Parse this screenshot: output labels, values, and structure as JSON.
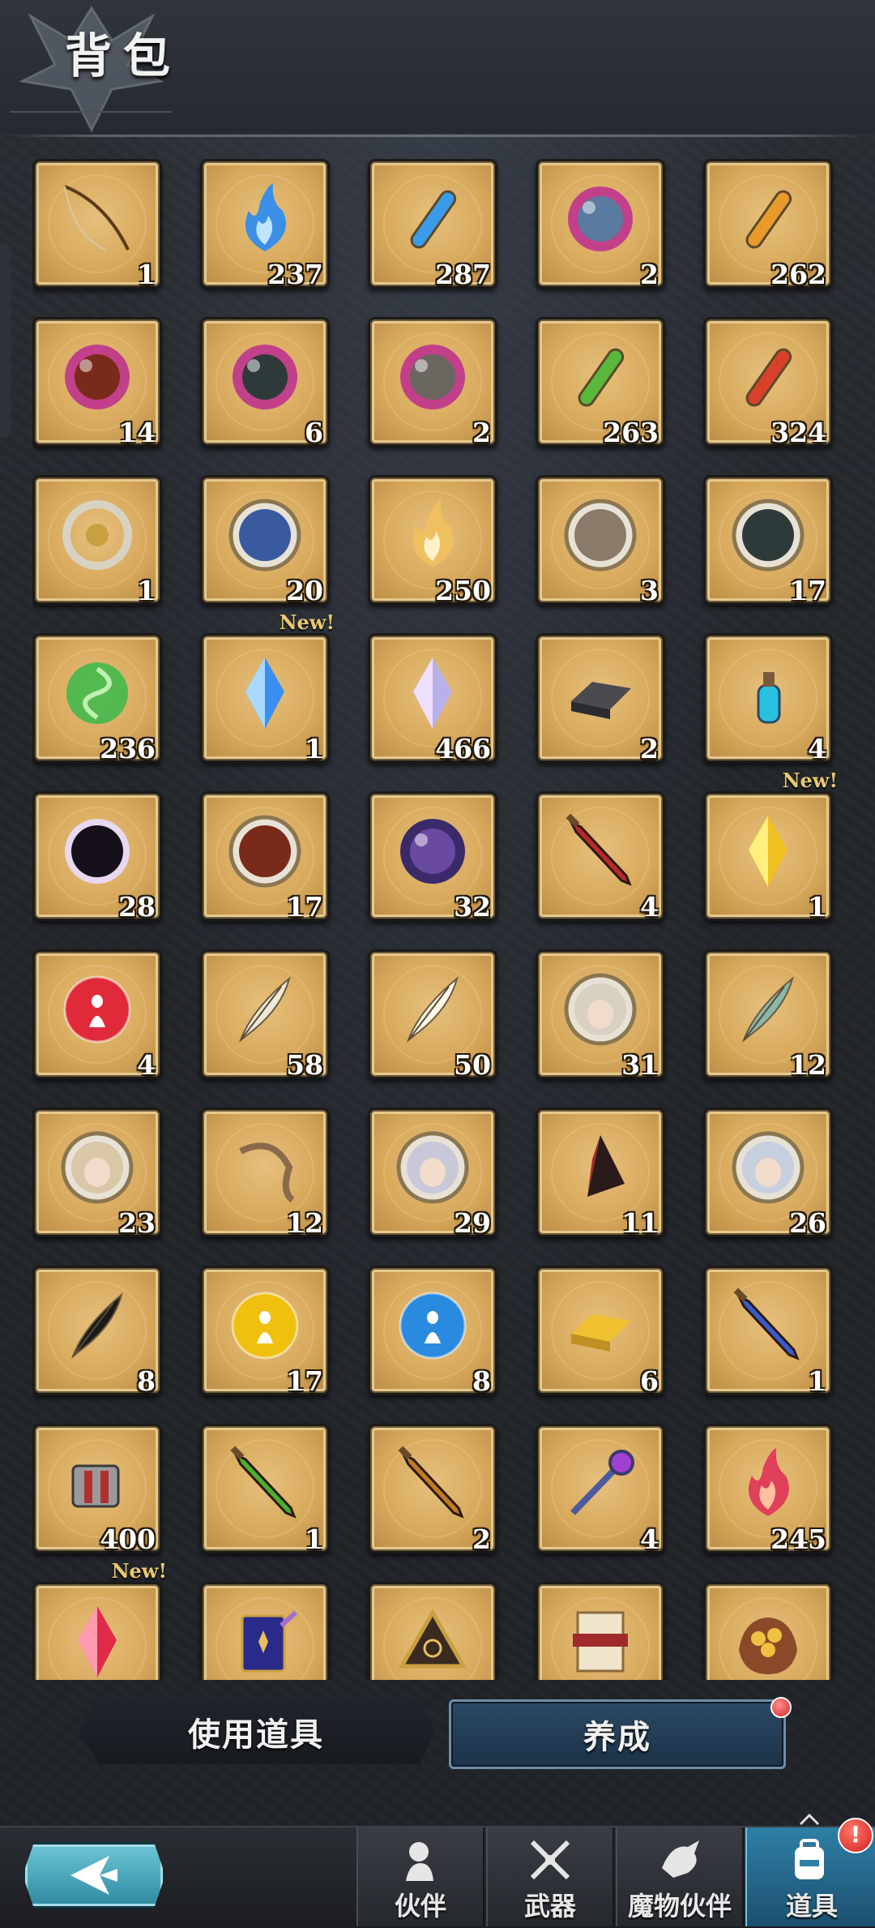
{
  "header": {
    "title": "背包"
  },
  "items": [
    {
      "icon": "fishing-rod-icon",
      "count": "1",
      "new": false
    },
    {
      "icon": "blue-flame-icon",
      "count": "237",
      "new": false
    },
    {
      "icon": "blue-vial-icon",
      "count": "287",
      "new": false
    },
    {
      "icon": "beast-orb-icon",
      "count": "2",
      "new": false
    },
    {
      "icon": "orange-vial-icon",
      "count": "262",
      "new": false
    },
    {
      "icon": "fire-orb-icon",
      "count": "14",
      "new": false
    },
    {
      "icon": "shadow-orb-icon",
      "count": "6",
      "new": false
    },
    {
      "icon": "stone-orb-icon",
      "count": "2",
      "new": false
    },
    {
      "icon": "green-vial-icon",
      "count": "263",
      "new": false
    },
    {
      "icon": "red-vial-icon",
      "count": "324",
      "new": false
    },
    {
      "icon": "silver-crest-icon",
      "count": "1",
      "new": false
    },
    {
      "icon": "blue-wave-medal-icon",
      "count": "20",
      "new": false
    },
    {
      "icon": "golden-flame-icon",
      "count": "250",
      "new": false
    },
    {
      "icon": "stone-medal-icon",
      "count": "3",
      "new": false
    },
    {
      "icon": "dark-medal-icon",
      "count": "17",
      "new": false
    },
    {
      "icon": "green-swirl-icon",
      "count": "236",
      "new": false
    },
    {
      "icon": "blue-crystal-icon",
      "count": "1",
      "new": true
    },
    {
      "icon": "prism-crystal-icon",
      "count": "466",
      "new": false
    },
    {
      "icon": "silver-ingot-icon",
      "count": "2",
      "new": false
    },
    {
      "icon": "cyan-potion-icon",
      "count": "4",
      "new": false
    },
    {
      "icon": "black-hole-icon",
      "count": "28",
      "new": false
    },
    {
      "icon": "lava-medal-icon",
      "count": "17",
      "new": false
    },
    {
      "icon": "purple-eye-orb-icon",
      "count": "32",
      "new": false
    },
    {
      "icon": "red-blade-icon",
      "count": "4",
      "new": false
    },
    {
      "icon": "gold-crystal-icon",
      "count": "1",
      "new": true
    },
    {
      "icon": "red-spirit-orb-icon",
      "count": "4",
      "new": false
    },
    {
      "icon": "white-feather-icon",
      "count": "58",
      "new": false
    },
    {
      "icon": "shining-feather-icon",
      "count": "50",
      "new": false
    },
    {
      "icon": "wolf-portrait-icon",
      "count": "31",
      "new": false
    },
    {
      "icon": "teal-feather-icon",
      "count": "12",
      "new": false
    },
    {
      "icon": "maiden-portrait-icon",
      "count": "23",
      "new": false
    },
    {
      "icon": "curved-horn-icon",
      "count": "12",
      "new": false
    },
    {
      "icon": "horned-girl-portrait-icon",
      "count": "29",
      "new": false
    },
    {
      "icon": "dark-fin-icon",
      "count": "11",
      "new": false
    },
    {
      "icon": "silver-hair-portrait-icon",
      "count": "26",
      "new": false
    },
    {
      "icon": "black-feather-icon",
      "count": "8",
      "new": false
    },
    {
      "icon": "yellow-spirit-orb-icon",
      "count": "17",
      "new": false
    },
    {
      "icon": "blue-spirit-orb-icon",
      "count": "8",
      "new": false
    },
    {
      "icon": "gold-bar-icon",
      "count": "6",
      "new": false
    },
    {
      "icon": "blue-blade-icon",
      "count": "1",
      "new": false
    },
    {
      "icon": "machine-part-icon",
      "count": "400",
      "new": false
    },
    {
      "icon": "green-blade-icon",
      "count": "1",
      "new": false
    },
    {
      "icon": "amber-blade-icon",
      "count": "2",
      "new": false
    },
    {
      "icon": "scepter-icon",
      "count": "4",
      "new": false
    },
    {
      "icon": "crimson-flame-icon",
      "count": "245",
      "new": false
    },
    {
      "icon": "red-crystal-icon",
      "count": "",
      "new": true
    },
    {
      "icon": "spellbook-icon",
      "count": "",
      "new": false
    },
    {
      "icon": "triangle-rune-icon",
      "count": "",
      "new": false
    },
    {
      "icon": "scroll-icon",
      "count": "",
      "new": false
    },
    {
      "icon": "treasure-bag-icon",
      "count": "",
      "new": false
    }
  ],
  "new_label": "New!",
  "actions": {
    "use_item": "使用道具",
    "cultivate": "养成"
  },
  "nav": {
    "partner": "伙伴",
    "weapon": "武器",
    "monster_partner": "魔物伙伴",
    "items": "道具",
    "alert": "!"
  }
}
